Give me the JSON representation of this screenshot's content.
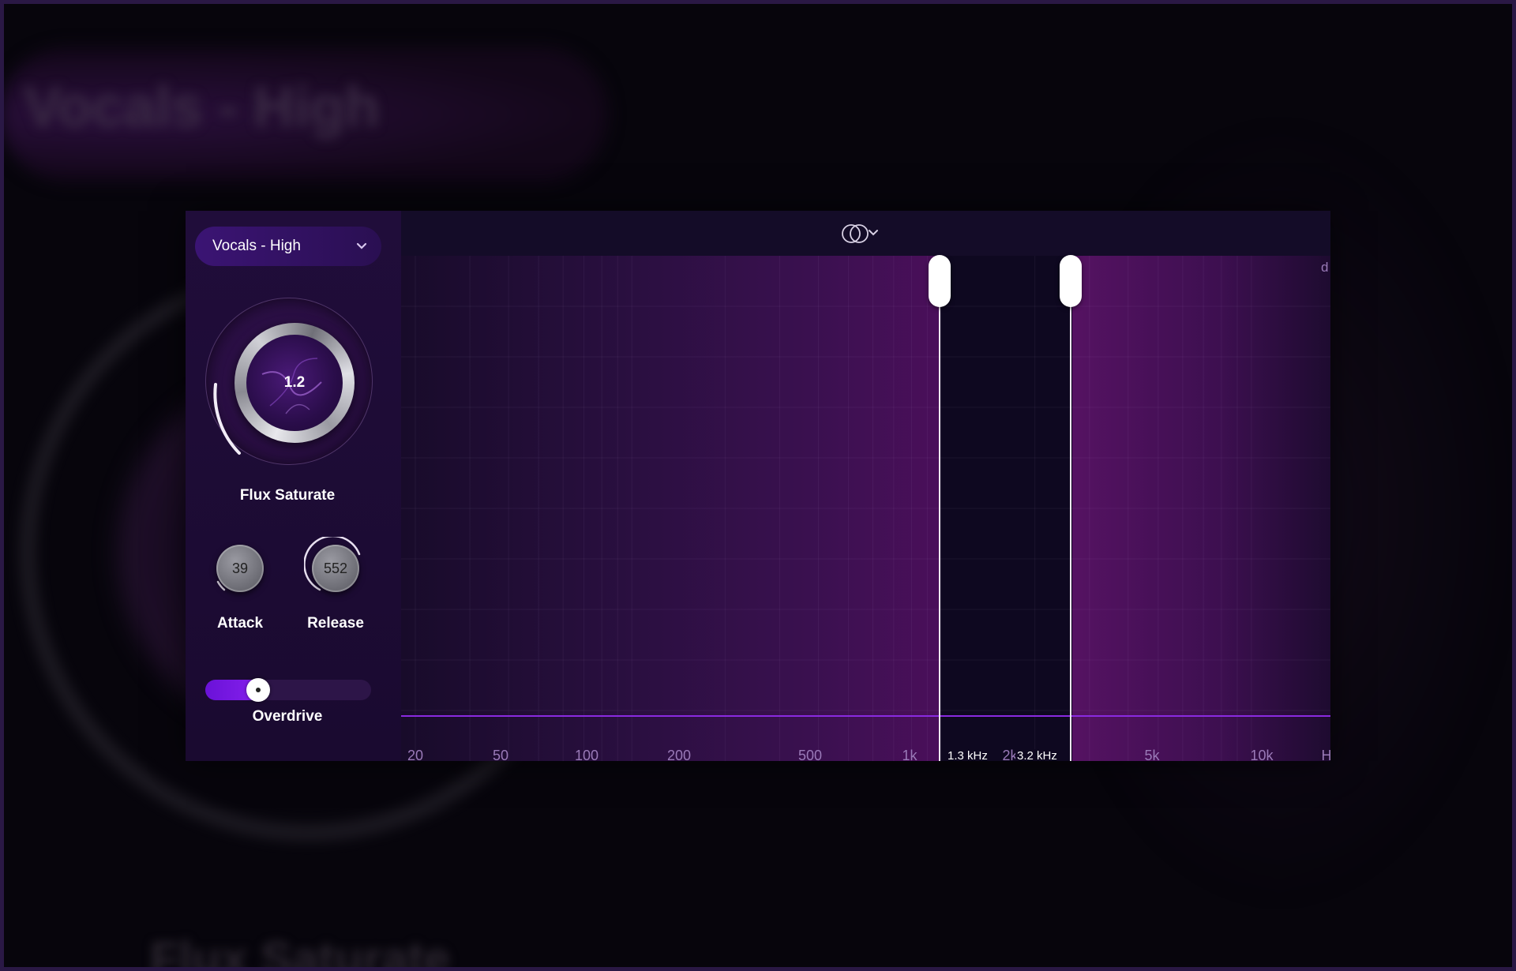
{
  "background": {
    "title": "Vocals - High",
    "bottom_text": "Flux Saturate"
  },
  "preset": {
    "label": "Vocals - High",
    "icon": "chevron-down-icon"
  },
  "knobs": {
    "flux_saturate": {
      "value": "1.2",
      "label": "Flux Saturate"
    },
    "attack": {
      "value": "39",
      "label": "Attack"
    },
    "release": {
      "value": "552",
      "label": "Release"
    }
  },
  "overdrive": {
    "label": "Overdrive",
    "level": 0.32
  },
  "spectrum": {
    "link_icon": "stereo-link-icon",
    "top_right_label": "d",
    "x_ticks": [
      "20",
      "50",
      "100",
      "200",
      "500",
      "1k",
      "2k",
      "5k",
      "10k",
      "H"
    ],
    "band_markers": [
      {
        "label": "1.3 kHz",
        "frequency_hz": 1300
      },
      {
        "label": "3.2 kHz",
        "frequency_hz": 3200
      }
    ]
  },
  "colors": {
    "accent": "#8a22f0",
    "panel": "#150c26",
    "band_highlight": "#551262"
  }
}
